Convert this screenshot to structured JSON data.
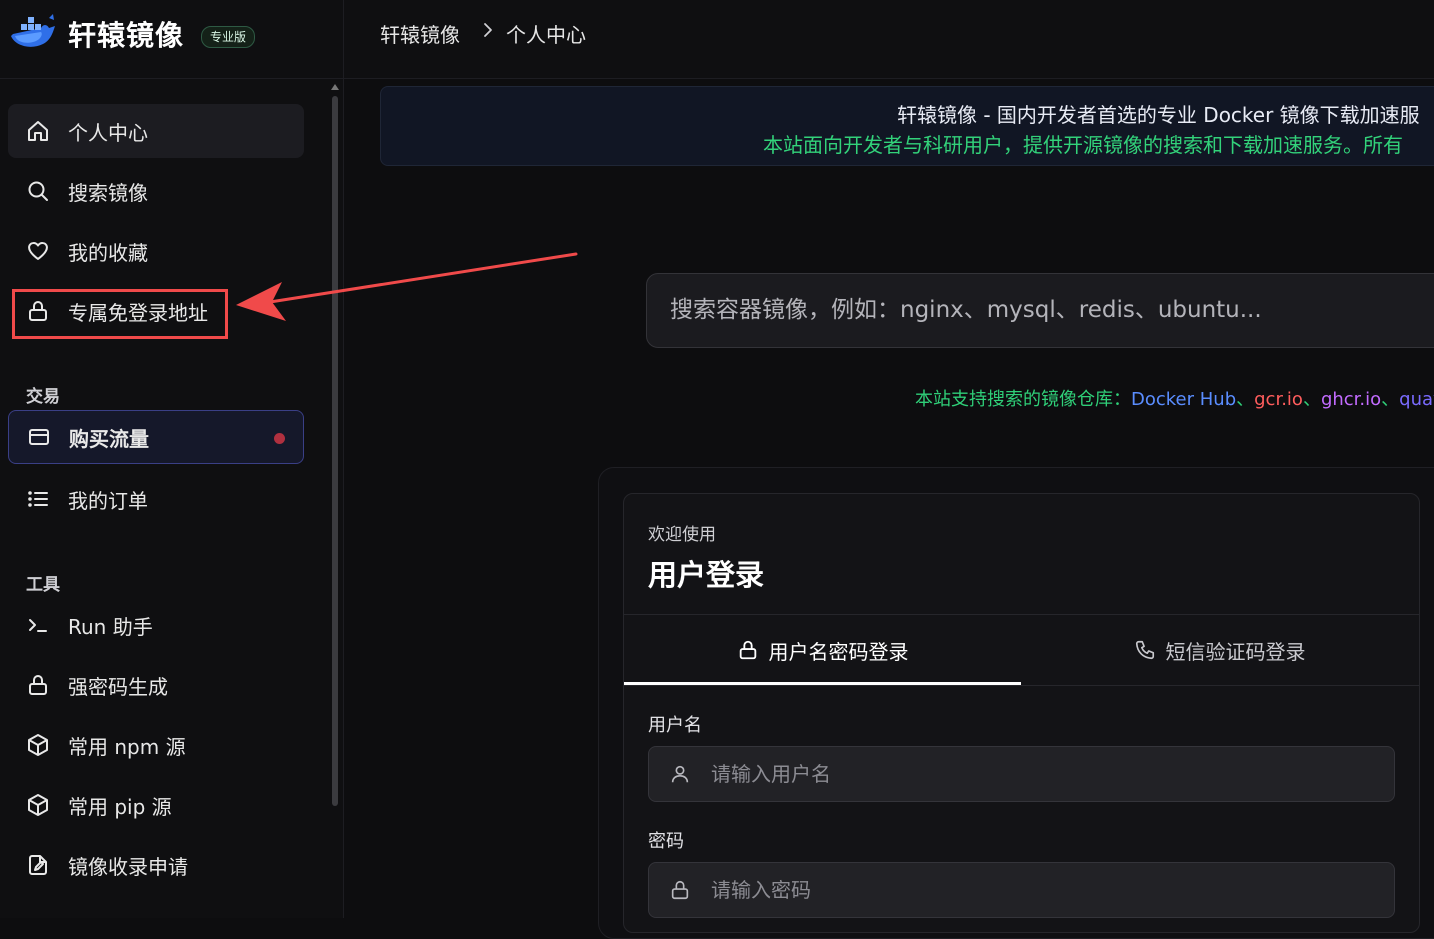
{
  "brand": {
    "name": "轩辕镜像",
    "badge": "专业版",
    "colors": {
      "logo": "#3a7bff",
      "badge_border": "#2e5a44"
    }
  },
  "sidebar": {
    "items": [
      {
        "label": "个人中心",
        "icon": "home-icon",
        "state": "active"
      },
      {
        "label": "搜索镜像",
        "icon": "search-icon"
      },
      {
        "label": "我的收藏",
        "icon": "heart-icon"
      },
      {
        "label": "专属免登录地址",
        "icon": "lock-icon",
        "annotated": true
      }
    ],
    "sections": [
      {
        "title": "交易",
        "items": [
          {
            "label": "购买流量",
            "icon": "card-icon",
            "state": "selected",
            "badge": "dot"
          },
          {
            "label": "我的订单",
            "icon": "list-icon"
          }
        ]
      },
      {
        "title": "工具",
        "items": [
          {
            "label": "Run 助手",
            "icon": "terminal-icon"
          },
          {
            "label": "强密码生成",
            "icon": "lock-icon"
          },
          {
            "label": "常用 npm 源",
            "icon": "package-icon"
          },
          {
            "label": "常用 pip 源",
            "icon": "package-icon"
          },
          {
            "label": "镜像收录申请",
            "icon": "edit-doc-icon"
          }
        ]
      }
    ]
  },
  "breadcrumb": [
    "轩辕镜像",
    "个人中心"
  ],
  "notice": {
    "line1": "轩辕镜像 - 国内开发者首选的专业 Docker 镜像下载加速服",
    "line2": "本站面向开发者与科研用户，提供开源镜像的搜索和下载加速服务。所有"
  },
  "search": {
    "placeholder": "搜索容器镜像，例如：nginx、mysql、redis、ubuntu..."
  },
  "registries": {
    "prefix": "本站支持搜索的镜像仓库：",
    "items": [
      {
        "name": "Docker Hub",
        "color": "#5a8dff"
      },
      {
        "name": "gcr.io",
        "color": "#ff5d5d"
      },
      {
        "name": "ghcr.io",
        "color": "#c26bff"
      },
      {
        "name": "quay",
        "color": "#7a6bff"
      }
    ],
    "separator": "、"
  },
  "login": {
    "welcome": "欢迎使用",
    "title": "用户登录",
    "tabs": [
      {
        "label": "用户名密码登录",
        "icon": "lock-icon",
        "active": true
      },
      {
        "label": "短信验证码登录",
        "icon": "phone-icon",
        "active": false
      }
    ],
    "username": {
      "label": "用户名",
      "placeholder": "请输入用户名",
      "value": ""
    },
    "password": {
      "label": "密码",
      "placeholder": "请输入密码",
      "value": ""
    }
  },
  "annotation": {
    "color": "#f04a4a"
  }
}
